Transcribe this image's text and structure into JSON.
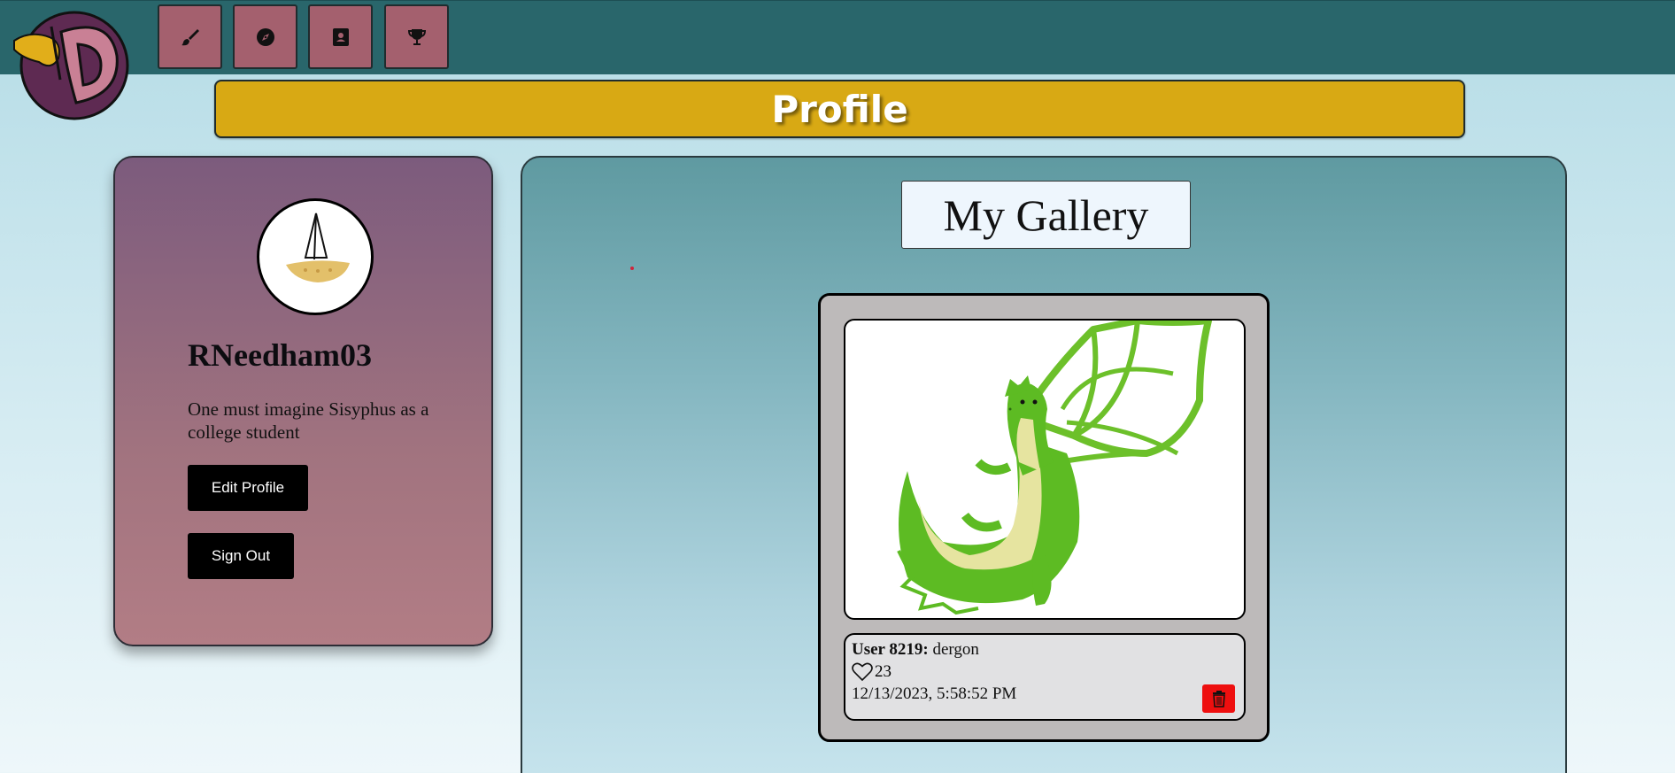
{
  "nav": {
    "items": [
      {
        "icon": "paintbrush-icon"
      },
      {
        "icon": "compass-icon"
      },
      {
        "icon": "contact-card-icon"
      },
      {
        "icon": "trophy-icon"
      }
    ]
  },
  "page": {
    "title": "Profile"
  },
  "profile": {
    "username": "RNeedham03",
    "bio": "One must imagine Sisyphus as a college student",
    "edit_label": "Edit Profile",
    "signout_label": "Sign Out"
  },
  "gallery": {
    "title": "My Gallery",
    "artworks": [
      {
        "user_label": "User 8219:",
        "name": "dergon",
        "likes": "23",
        "date": "12/13/2023, 5:58:52 PM"
      }
    ]
  },
  "colors": {
    "topbar": "#29666b",
    "nav_button": "#a4606e",
    "banner": "#d8a914",
    "delete": "#ee0f0f"
  }
}
